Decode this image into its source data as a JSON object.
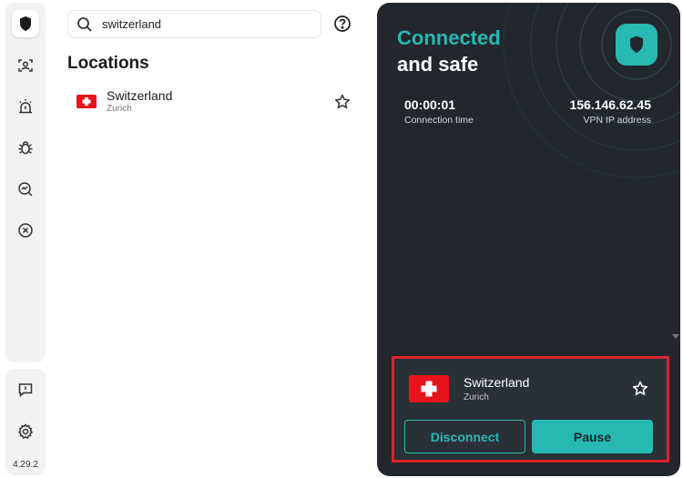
{
  "sidebar": {
    "items": [
      {
        "icon": "shield-icon",
        "active": true
      },
      {
        "icon": "user-scan-icon"
      },
      {
        "icon": "alarm-icon"
      },
      {
        "icon": "bug-icon"
      },
      {
        "icon": "magnify-chart-icon"
      },
      {
        "icon": "close-circle-icon"
      }
    ],
    "bottom_items": [
      {
        "icon": "feedback-icon"
      },
      {
        "icon": "gear-icon"
      }
    ],
    "version": "4.29.2"
  },
  "search": {
    "value": "switzerland"
  },
  "locations": {
    "title": "Locations",
    "items": [
      {
        "name": "Switzerland",
        "city": "Zurich"
      }
    ]
  },
  "status": {
    "line1": "Connected",
    "line2": "and safe",
    "connection_time": "00:00:01",
    "connection_time_label": "Connection time",
    "vpn_ip": "156.146.62.45",
    "vpn_ip_label": "VPN IP address"
  },
  "current_connection": {
    "name": "Switzerland",
    "city": "Zurich",
    "disconnect_label": "Disconnect",
    "pause_label": "Pause"
  },
  "colors": {
    "accent": "#27b9b3",
    "panel": "#22272d",
    "highlight_border": "#d9242a",
    "flag_red": "#e8141b"
  }
}
